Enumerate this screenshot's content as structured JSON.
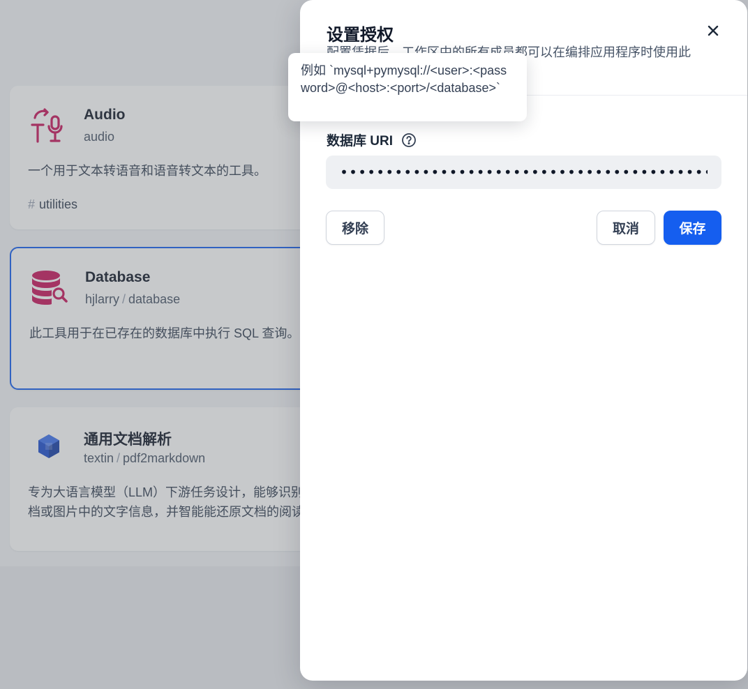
{
  "cards": [
    {
      "title": "Audio",
      "sub": "audio",
      "desc": "一个用于文本转语音和语音转文本的工具。",
      "tag": "utilities",
      "icon": "text-to-speech-icon",
      "icon_color": "#c8175d"
    },
    {
      "title": "Database",
      "sub_author": "hjlarry",
      "sub_name": "database",
      "desc": "此工具用于在已存在的数据库中执行 SQL 查询。",
      "icon": "database-search-icon",
      "icon_color": "#c8175d"
    },
    {
      "title": "通用文档解析",
      "sub_author": "textin",
      "sub_name": "pdf2markdown",
      "desc_line1": "专为大语言模型（LLM）下游任务设计，能够识别",
      "desc_line2": "档或图片中的文字信息，并智能能还原文档的阅读顺",
      "icon": "cube-icon",
      "icon_color": "#1f4fcf"
    }
  ],
  "separator": "/",
  "tag_hash": "#",
  "dialog": {
    "title": "设置授权",
    "description": "配置凭据后，工作区中的所有成员都可以在编排应用程序时使用此",
    "field_label": "数据库 URI",
    "uri_value": "••••••••••••••••••••••••••••••••••••••••••••••••",
    "remove_label": "移除",
    "cancel_label": "取消",
    "save_label": "保存",
    "accent_color": "#155eef"
  },
  "tooltip": {
    "text": "例如 `mysql+pymysql://<user>:<password>@<host>:<port>/<database>`"
  }
}
